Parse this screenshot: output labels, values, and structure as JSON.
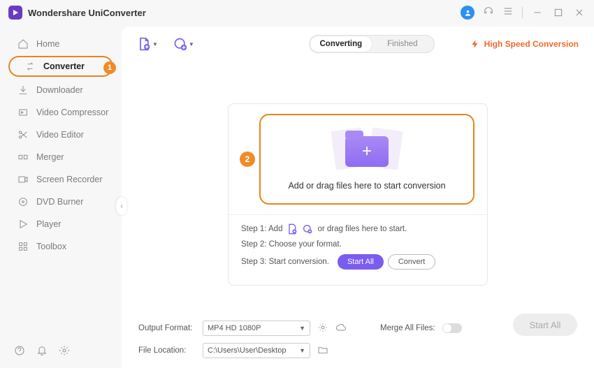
{
  "app": {
    "title": "Wondershare UniConverter"
  },
  "sidebar": {
    "items": [
      {
        "label": "Home"
      },
      {
        "label": "Converter"
      },
      {
        "label": "Downloader"
      },
      {
        "label": "Video Compressor"
      },
      {
        "label": "Video Editor"
      },
      {
        "label": "Merger"
      },
      {
        "label": "Screen Recorder"
      },
      {
        "label": "DVD Burner"
      },
      {
        "label": "Player"
      },
      {
        "label": "Toolbox"
      }
    ],
    "badge1": "1"
  },
  "tabs": {
    "converting": "Converting",
    "finished": "Finished"
  },
  "hsc": "High Speed Conversion",
  "drop": {
    "badge": "2",
    "text": "Add or drag files here to start conversion"
  },
  "steps": {
    "s1a": "Step 1: Add",
    "s1b": "or drag files here to start.",
    "s2": "Step 2: Choose your format.",
    "s3": "Step 3: Start conversion.",
    "startAll": "Start All",
    "convert": "Convert"
  },
  "footer": {
    "outputLabel": "Output Format:",
    "outputValue": "MP4 HD 1080P",
    "locationLabel": "File Location:",
    "locationValue": "C:\\Users\\User\\Desktop",
    "mergeLabel": "Merge All Files:",
    "startAll": "Start All"
  }
}
